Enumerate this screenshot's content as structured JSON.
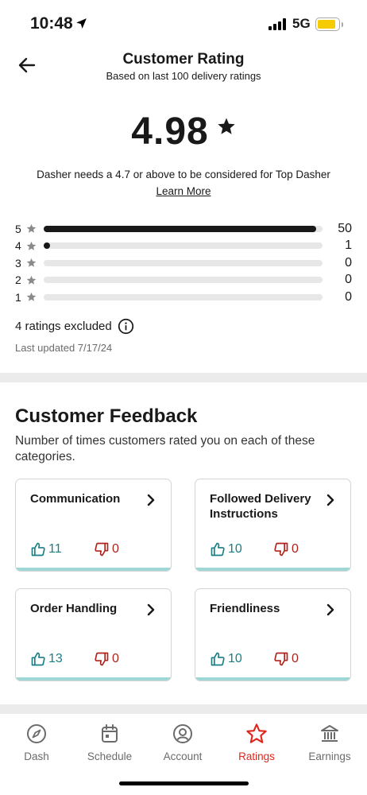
{
  "status_bar": {
    "time": "10:48",
    "network": "5G"
  },
  "header": {
    "title": "Customer Rating",
    "subtitle": "Based on last 100 delivery ratings"
  },
  "rating": {
    "value": "4.98"
  },
  "info": {
    "top_dasher_note": "Dasher needs a 4.7 or above to be considered for Top Dasher",
    "learn_more": "Learn More"
  },
  "distribution": [
    {
      "stars": "5",
      "count": "50",
      "fraction": 1.0
    },
    {
      "stars": "4",
      "count": "1",
      "fraction": 0.02
    },
    {
      "stars": "3",
      "count": "0",
      "fraction": 0
    },
    {
      "stars": "2",
      "count": "0",
      "fraction": 0
    },
    {
      "stars": "1",
      "count": "0",
      "fraction": 0
    }
  ],
  "excluded": "4 ratings excluded",
  "last_updated": "Last updated 7/17/24",
  "feedback": {
    "title": "Customer Feedback",
    "description": "Number of times customers rated you on each of these categories.",
    "cards": [
      {
        "title": "Communication",
        "up": "11",
        "down": "0"
      },
      {
        "title": "Followed Delivery Instructions",
        "up": "10",
        "down": "0"
      },
      {
        "title": "Order Handling",
        "up": "13",
        "down": "0"
      },
      {
        "title": "Friendliness",
        "up": "10",
        "down": "0"
      }
    ]
  },
  "tabs": [
    {
      "label": "Dash",
      "icon": "compass-icon"
    },
    {
      "label": "Schedule",
      "icon": "calendar-icon"
    },
    {
      "label": "Account",
      "icon": "account-icon"
    },
    {
      "label": "Ratings",
      "icon": "star-icon",
      "active": true
    },
    {
      "label": "Earnings",
      "icon": "bank-icon"
    }
  ],
  "colors": {
    "accent": "#e0251b",
    "thumbs_up": "#1a7f85",
    "thumbs_down": "#b0231c",
    "card_bar": "#9fd7d6"
  }
}
